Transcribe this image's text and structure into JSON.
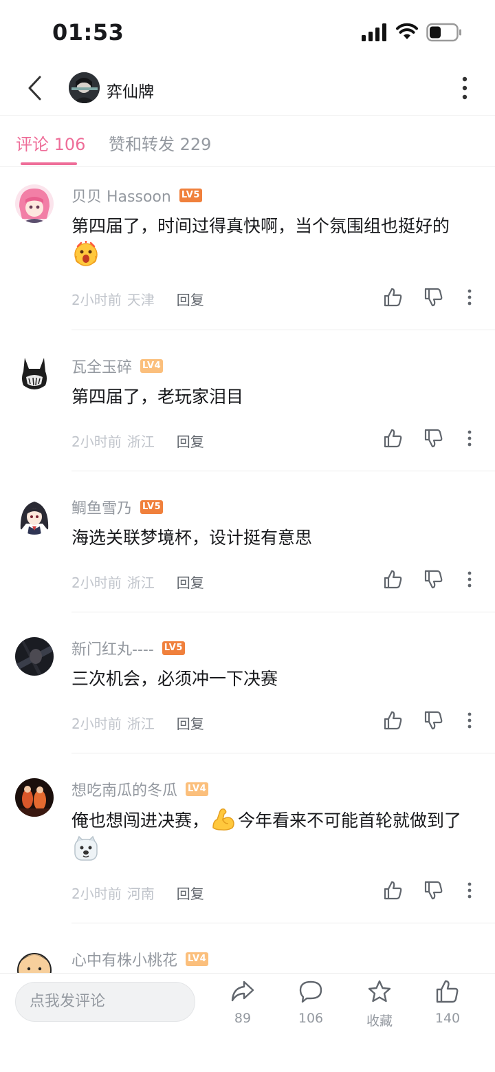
{
  "status_bar": {
    "time": "01:53"
  },
  "header": {
    "author_name": "弈仙牌"
  },
  "tabs": [
    {
      "label": "评论 106",
      "active": true
    },
    {
      "label": "赞和转发 229",
      "active": false
    }
  ],
  "comments": [
    {
      "user": "贝贝 Hassoon",
      "level": "LV5",
      "text_before": "第四届了，时间过得真快啊，当个氛围组也挺好的",
      "emoji_1": "screaming-face-emoji",
      "time": "2小时前",
      "location": "天津",
      "reply": "回复"
    },
    {
      "user": "瓦全玉碎",
      "level": "LV4",
      "text": "第四届了，老玩家泪目",
      "time": "2小时前",
      "location": "浙江",
      "reply": "回复"
    },
    {
      "user": "鲷鱼雪乃",
      "level": "LV5",
      "text": "海选关联梦境杯，设计挺有意思",
      "time": "2小时前",
      "location": "浙江",
      "reply": "回复"
    },
    {
      "user": "新门红丸----",
      "level": "LV5",
      "text": "三次机会，必须冲一下决赛",
      "time": "2小时前",
      "location": "浙江",
      "reply": "回复"
    },
    {
      "user": "想吃南瓜的冬瓜",
      "level": "LV4",
      "text_before": "俺也想闯进决赛，",
      "emoji_1": "flexed-biceps-emoji",
      "text_mid": "今年看来不可能首轮就做到了",
      "emoji_2": "dog-face-emoji",
      "time": "2小时前",
      "location": "河南",
      "reply": "回复"
    },
    {
      "user": "心中有株小桃花",
      "level": "LV4"
    }
  ],
  "bottom_bar": {
    "input_placeholder": "点我发评论",
    "share_count": "89",
    "comment_count": "106",
    "favorite_label": "收藏",
    "like_count": "140"
  },
  "colors": {
    "accent": "#ee6d98",
    "level5": "#f0803c",
    "level4": "#fbbf7c"
  }
}
